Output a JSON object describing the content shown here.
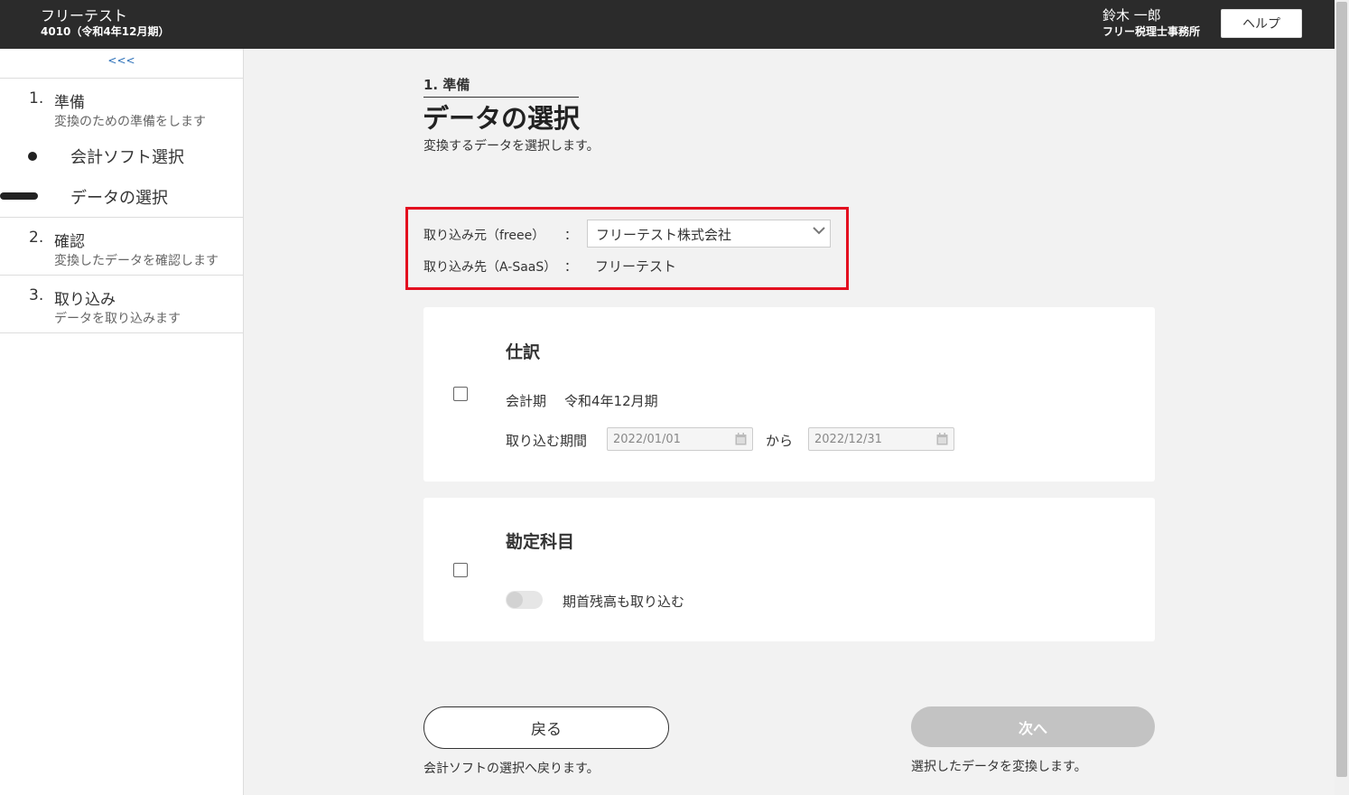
{
  "header": {
    "app_title": "フリーテスト",
    "app_subtitle": "4010（令和4年12月期）",
    "user_name": "鈴木 一郎",
    "user_office": "フリー税理士事務所",
    "help_label": "ヘルプ"
  },
  "sidebar": {
    "collapse_label": "<<<",
    "steps": [
      {
        "num": "1.",
        "title": "準備",
        "desc": "変換のための準備をします",
        "substeps": [
          "会計ソフト選択",
          "データの選択"
        ]
      },
      {
        "num": "2.",
        "title": "確認",
        "desc": "変換したデータを確認します"
      },
      {
        "num": "3.",
        "title": "取り込み",
        "desc": "データを取り込みます"
      }
    ]
  },
  "main": {
    "crumb": "1. 準備",
    "title": "データの選択",
    "description": "変換するデータを選択します。",
    "source_label": "取り込み元（freee）",
    "colon": "：",
    "source_value": "フリーテスト株式会社",
    "dest_label": "取り込み先（A-SaaS）",
    "dest_value": "フリーテスト",
    "journal": {
      "title": "仕訳",
      "period_label": "会計期",
      "period_value": "令和4年12月期",
      "range_label": "取り込む期間",
      "date_from": "2022/01/01",
      "from_word": "から",
      "date_to": "2022/12/31"
    },
    "accounts": {
      "title": "勘定科目",
      "toggle_label": "期首残高も取り込む"
    },
    "back_label": "戻る",
    "back_desc": "会計ソフトの選択へ戻ります。",
    "next_label": "次へ",
    "next_desc": "選択したデータを変換します。"
  },
  "colors": {
    "header_bg": "#2b2b2b",
    "highlight_border": "#e30e1f",
    "next_disabled": "#c3c3c3"
  }
}
